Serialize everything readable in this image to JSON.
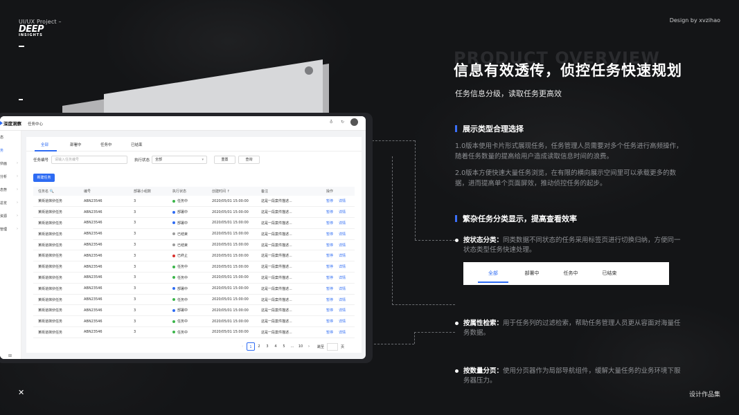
{
  "meta": {
    "project": "UI/UX Project –",
    "logo_main": "DEEP",
    "logo_sub": "INSIGHTS",
    "design_by": "Design by xvzihao",
    "portfolio": "设计作品集",
    "ghost_title": "PRODUCT OVERVIEW"
  },
  "hero": {
    "title": "信息有效透传，侦控任务快速规划",
    "subtitle": "任务信息分级，读取任务更高效"
  },
  "section1": {
    "title": "展示类型合理选择",
    "p1": "1.0版本使用卡片形式展现任务，任务管理人员需要对多个任务进行高频操作，随着任务数量的提高给用户造成读取信息时间的浪费。",
    "p2": "2.0版本方便快速大量任务浏览，在有限的横向展示空间里可以承载更多的数据，进而提高单个页面屏效，推动侦控任务的起步。"
  },
  "section2": {
    "title": "繁杂任务分类显示，提高查看效率",
    "b1_label": "按状态分类：",
    "b1_text": "同类数据不同状态的任务采用标签页进行切换归纳，方便同一状态类型任务快速处理。",
    "b2_label": "按属性检索：",
    "b2_text": "用于任务列的过滤检索，帮助任务管理人员更从容面对海量任务数据。",
    "b3_label": "按数量分页：",
    "b3_text": "使用分页器作为局部导航组件，缓解大量任务的业务环境下服务器压力。"
  },
  "tab_demo": [
    "全部",
    "部署中",
    "任务中",
    "已结束"
  ],
  "app": {
    "brand": "深度洞察",
    "page": "任务中心",
    "sidebar": [
      "态",
      "务",
      "侦画",
      "分析",
      "态势",
      "总览",
      "资源",
      "管理"
    ],
    "tabs": [
      "全部",
      "部署中",
      "任务中",
      "已结束"
    ],
    "filter": {
      "label1": "任务编号",
      "placeholder1": "请输入任务编号",
      "label2": "执行状态",
      "select": "全部",
      "reset": "重置",
      "query": "查询"
    },
    "new_task": "新建任务",
    "columns": [
      "任务名 🔍",
      "编号",
      "部署小组数",
      "执行状态",
      "创建时间 ↑",
      "备注",
      "操作"
    ],
    "rows": [
      {
        "name": "某街道抹侦任务",
        "code": "ABN23546",
        "groups": "3",
        "status": "任务中",
        "status_color": "#3bb54a",
        "time": "2020/05/01 15:00:00",
        "note": "这是一段案件描述..."
      },
      {
        "name": "某街道抹侦任务",
        "code": "ABN23546",
        "groups": "3",
        "status": "部署中",
        "status_color": "#2d6bf3",
        "time": "2020/05/01 15:00:00",
        "note": "这是一段案件描述..."
      },
      {
        "name": "某街道抹侦任务",
        "code": "ABN23546",
        "groups": "3",
        "status": "部署中",
        "status_color": "#2d6bf3",
        "time": "2020/05/01 15:00:00",
        "note": "这是一段案件描述..."
      },
      {
        "name": "某街道抹侦任务",
        "code": "ABN23546",
        "groups": "3",
        "status": "已结束",
        "status_color": "#9a9a9a",
        "time": "2020/05/01 15:00:00",
        "note": "这是一段案件描述..."
      },
      {
        "name": "某街道抹侦任务",
        "code": "ABN23546",
        "groups": "3",
        "status": "已结束",
        "status_color": "#9a9a9a",
        "time": "2020/05/01 15:00:00",
        "note": "这是一段案件描述..."
      },
      {
        "name": "某街道抹侦任务",
        "code": "ABN23546",
        "groups": "3",
        "status": "已终止",
        "status_color": "#d9302c",
        "time": "2020/05/01 15:00:00",
        "note": "这是一段案件描述..."
      },
      {
        "name": "某街道抹侦任务",
        "code": "ABN23546",
        "groups": "3",
        "status": "任务中",
        "status_color": "#3bb54a",
        "time": "2020/05/01 15:00:00",
        "note": "这是一段案件描述..."
      },
      {
        "name": "某街道抹侦任务",
        "code": "ABN23546",
        "groups": "3",
        "status": "任务中",
        "status_color": "#3bb54a",
        "time": "2020/05/01 15:00:00",
        "note": "这是一段案件描述..."
      },
      {
        "name": "某街道抹侦任务",
        "code": "ABN23546",
        "groups": "3",
        "status": "部署中",
        "status_color": "#2d6bf3",
        "time": "2020/05/01 15:00:00",
        "note": "这是一段案件描述..."
      },
      {
        "name": "某街道抹侦任务",
        "code": "ABN23546",
        "groups": "3",
        "status": "任务中",
        "status_color": "#3bb54a",
        "time": "2020/05/01 15:00:00",
        "note": "这是一段案件描述..."
      },
      {
        "name": "某街道抹侦任务",
        "code": "ABN23546",
        "groups": "3",
        "status": "部署中",
        "status_color": "#2d6bf3",
        "time": "2020/05/01 15:00:00",
        "note": "这是一段案件描述..."
      },
      {
        "name": "某街道抹侦任务",
        "code": "ABN23546",
        "groups": "3",
        "status": "任务中",
        "status_color": "#3bb54a",
        "time": "2020/05/01 15:00:00",
        "note": "这是一段案件描述..."
      },
      {
        "name": "某街道抹侦任务",
        "code": "ABN23546",
        "groups": "3",
        "status": "任务中",
        "status_color": "#3bb54a",
        "time": "2020/05/01 15:00:00",
        "note": "这是一段案件描述..."
      }
    ],
    "ops": {
      "pause": "暂停",
      "detail": "详情"
    },
    "pager": {
      "prev": "‹",
      "pages": [
        "1",
        "2",
        "3",
        "4",
        "5",
        "...",
        "10"
      ],
      "next": "›",
      "jump": "跳至",
      "unit": "页"
    }
  }
}
